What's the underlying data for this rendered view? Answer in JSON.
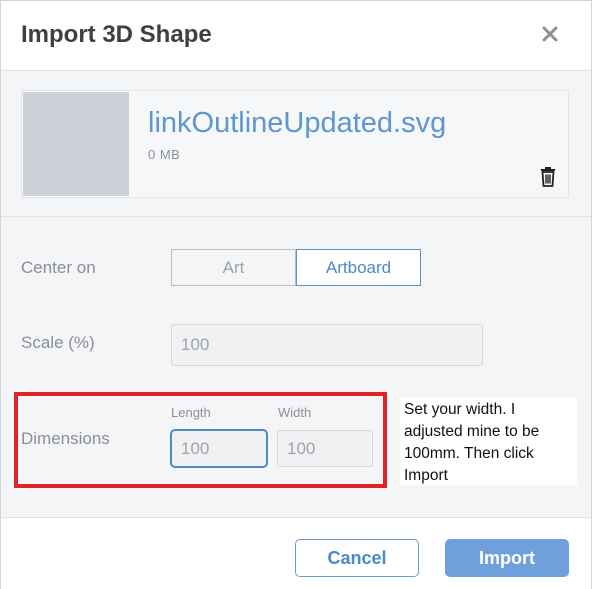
{
  "dialog": {
    "title": "Import 3D Shape",
    "close_icon": "close-icon"
  },
  "file": {
    "name": "linkOutlineUpdated.svg",
    "size": "0 MB",
    "delete_icon": "trash-icon"
  },
  "center_on": {
    "label": "Center on",
    "options": [
      "Art",
      "Artboard"
    ],
    "selected": "Artboard"
  },
  "scale": {
    "label": "Scale (%)",
    "value": "100"
  },
  "dimensions": {
    "label": "Dimensions",
    "length_label": "Length",
    "length_value": "100",
    "width_label": "Width",
    "width_value": "100"
  },
  "annotation": {
    "note": "Set your width. I adjusted mine to be 100mm. Then click Import",
    "highlight_color": "#e0232b"
  },
  "footer": {
    "cancel_label": "Cancel",
    "import_label": "Import"
  },
  "colors": {
    "accent": "#4d88c8",
    "primary_button": "#6fa0dc"
  }
}
